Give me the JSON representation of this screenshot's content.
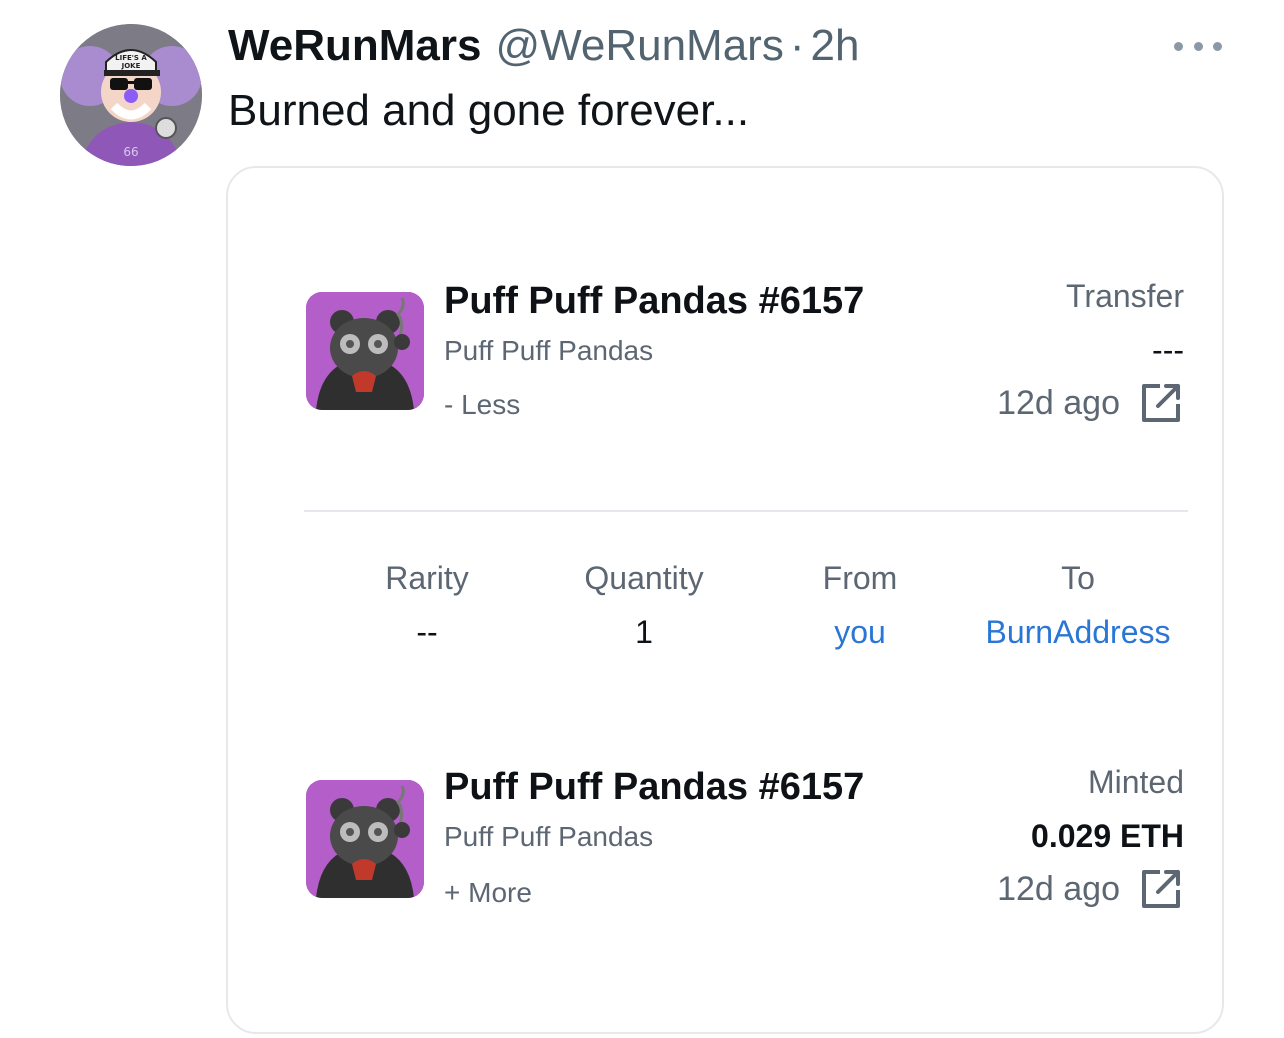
{
  "tweet": {
    "display_name": "WeRunMars",
    "handle": "@WeRunMars",
    "separator": "·",
    "time": "2h",
    "text": "Burned and gone forever...",
    "avatar_cap_text": "LIFE'S A JOKE"
  },
  "card": {
    "transfer_item": {
      "title": "Puff Puff Pandas #6157",
      "collection": "Puff Puff Pandas",
      "toggle": "- Less",
      "event_type": "Transfer",
      "price": "---",
      "ago": "12d ago"
    },
    "details": [
      {
        "label": "Rarity",
        "value": "--"
      },
      {
        "label": "Quantity",
        "value": "1"
      },
      {
        "label": "From",
        "value": "you"
      },
      {
        "label": "To",
        "value": "BurnAddress"
      }
    ],
    "minted_item": {
      "title": "Puff Puff Pandas #6157",
      "collection": "Puff Puff Pandas",
      "toggle": "+ More",
      "event_type": "Minted",
      "price": "0.029 ETH",
      "ago": "12d ago"
    }
  },
  "colors": {
    "link": "#2a76d6",
    "thumb_bg": "#b45ec9",
    "secondary_text": "#5d6773"
  },
  "icons": [
    "more-icon",
    "external-link-icon"
  ]
}
